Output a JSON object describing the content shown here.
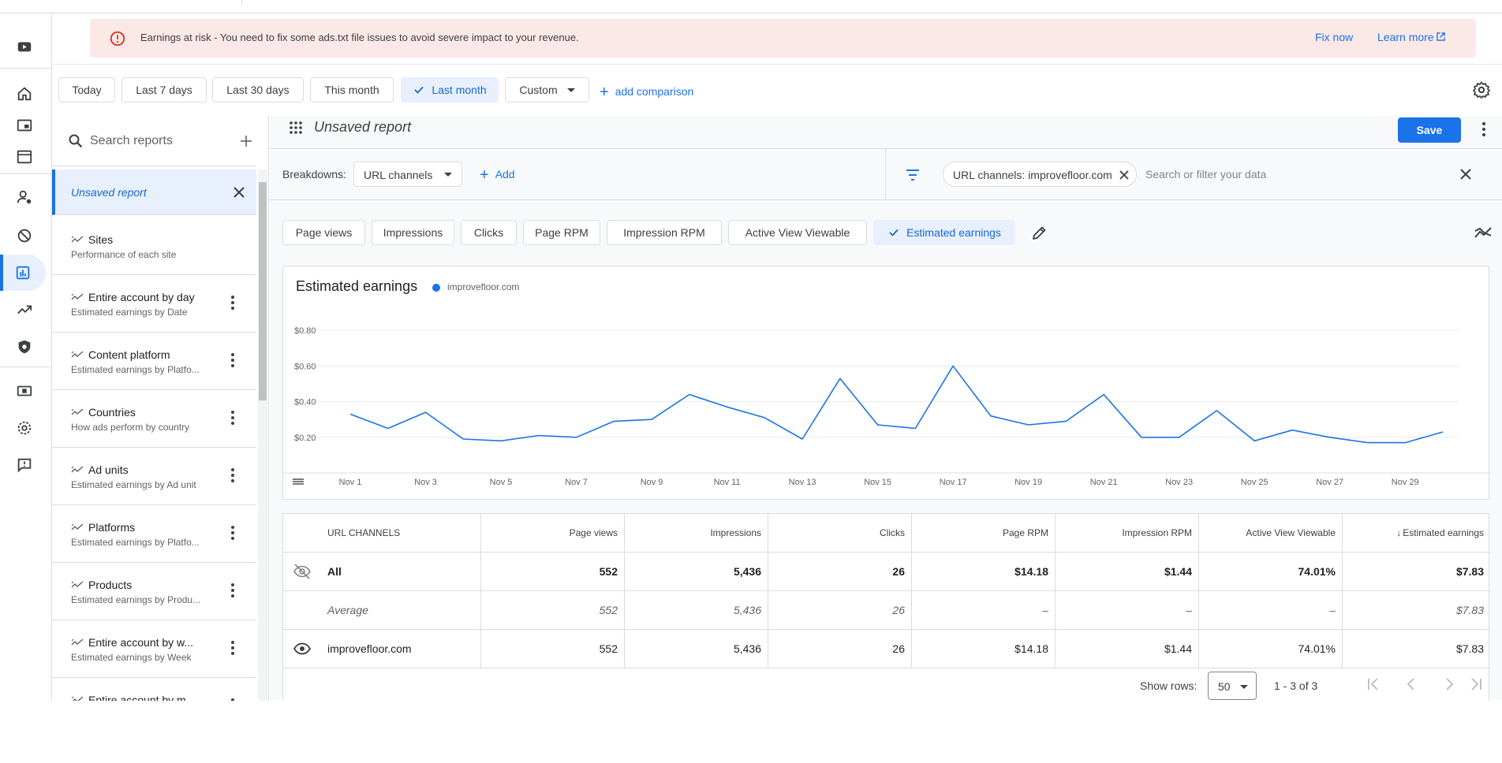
{
  "colors": {
    "accent": "#1a73e8",
    "banner_bg": "#fce8e6",
    "warning": "#d93025",
    "selected_bg": "#e8f0fe"
  },
  "rail": {
    "items": [
      {
        "icon": "youtube-icon"
      },
      {
        "icon": "home-icon"
      },
      {
        "icon": "ads-icon"
      },
      {
        "icon": "sites-icon"
      },
      {
        "icon": "privacy-messaging-icon"
      },
      {
        "icon": "blocking-controls-icon"
      },
      {
        "icon": "reports-icon"
      },
      {
        "icon": "optimization-icon"
      },
      {
        "icon": "policy-center-icon"
      },
      {
        "icon": "payments-icon"
      },
      {
        "icon": "settings-icon"
      },
      {
        "icon": "feedback-icon"
      }
    ],
    "active": "reports-icon"
  },
  "banner": {
    "message": "Earnings at risk - You need to fix some ads.txt file issues to avoid severe impact to your revenue.",
    "fix_now": "Fix now",
    "learn_more": "Learn more"
  },
  "date_range": {
    "today": "Today",
    "last7": "Last 7 days",
    "last30": "Last 30 days",
    "this_month": "This month",
    "last_month": "Last month",
    "custom": "Custom",
    "add_comparison": "add comparison",
    "selected": "Last month"
  },
  "sidebar": {
    "search_placeholder": "Search reports",
    "unsaved": "Unsaved report",
    "items": [
      {
        "title": "Sites",
        "subtitle": "Performance of each site"
      },
      {
        "title": "Entire account by day",
        "subtitle": "Estimated earnings by Date"
      },
      {
        "title": "Content platform",
        "subtitle": "Estimated earnings by Platfo..."
      },
      {
        "title": "Countries",
        "subtitle": "How ads perform by country"
      },
      {
        "title": "Ad units",
        "subtitle": "Estimated earnings by Ad unit"
      },
      {
        "title": "Platforms",
        "subtitle": "Estimated earnings by Platfo..."
      },
      {
        "title": "Products",
        "subtitle": "Estimated earnings by Produ..."
      },
      {
        "title": "Entire account by w...",
        "subtitle": "Estimated earnings by Week"
      },
      {
        "title": "Entire account by m...",
        "subtitle": ""
      }
    ]
  },
  "report": {
    "title": "Unsaved report",
    "save": "Save",
    "breakdowns_label": "Breakdowns:",
    "breakdown_value": "URL channels",
    "add": "Add",
    "filter_chip": "URL channels: improvefloor.com",
    "filter_placeholder": "Search or filter your data"
  },
  "metrics": [
    "Page views",
    "Impressions",
    "Clicks",
    "Page RPM",
    "Impression RPM",
    "Active View Viewable",
    "Estimated earnings"
  ],
  "selected_metric": "Estimated earnings",
  "chart_data": {
    "type": "line",
    "title": "Estimated earnings",
    "series": [
      {
        "name": "improvefloor.com",
        "color": "#1a73e8",
        "values": [
          0.33,
          0.25,
          0.34,
          0.19,
          0.18,
          0.21,
          0.2,
          0.29,
          0.3,
          0.44,
          0.37,
          0.31,
          0.19,
          0.53,
          0.27,
          0.25,
          0.6,
          0.32,
          0.27,
          0.29,
          0.44,
          0.2,
          0.2,
          0.35,
          0.18,
          0.24,
          0.2,
          0.17,
          0.17,
          0.23
        ]
      }
    ],
    "x": [
      "Nov 1",
      "Nov 2",
      "Nov 3",
      "Nov 4",
      "Nov 5",
      "Nov 6",
      "Nov 7",
      "Nov 8",
      "Nov 9",
      "Nov 10",
      "Nov 11",
      "Nov 12",
      "Nov 13",
      "Nov 14",
      "Nov 15",
      "Nov 16",
      "Nov 17",
      "Nov 18",
      "Nov 19",
      "Nov 20",
      "Nov 21",
      "Nov 22",
      "Nov 23",
      "Nov 24",
      "Nov 25",
      "Nov 26",
      "Nov 27",
      "Nov 28",
      "Nov 29",
      "Nov 30"
    ],
    "xtick_labels": [
      "Nov 1",
      "Nov 3",
      "Nov 5",
      "Nov 7",
      "Nov 9",
      "Nov 11",
      "Nov 13",
      "Nov 15",
      "Nov 17",
      "Nov 19",
      "Nov 21",
      "Nov 23",
      "Nov 25",
      "Nov 27",
      "Nov 29"
    ],
    "yticks": [
      0.2,
      0.4,
      0.6,
      0.8
    ],
    "ytick_labels": [
      "$0.20",
      "$0.40",
      "$0.60",
      "$0.80"
    ],
    "ylim": [
      0.0,
      0.92
    ],
    "grid": true,
    "legend": "top-left"
  },
  "table": {
    "columns": [
      "URL CHANNELS",
      "Page views",
      "Impressions",
      "Clicks",
      "Page RPM",
      "Impression RPM",
      "Active View Viewable",
      "Estimated earnings"
    ],
    "sorted_column": "Estimated earnings",
    "rows": [
      {
        "label": "All",
        "cells": [
          "552",
          "5,436",
          "26",
          "$14.18",
          "$1.44",
          "74.01%",
          "$7.83"
        ]
      },
      {
        "label": "Average",
        "cells": [
          "552",
          "5,436",
          "26",
          "–",
          "–",
          "–",
          "$7.83"
        ]
      },
      {
        "label": "improvefloor.com",
        "cells": [
          "552",
          "5,436",
          "26",
          "$14.18",
          "$1.44",
          "74.01%",
          "$7.83"
        ]
      }
    ],
    "show_rows_label": "Show rows:",
    "rows_per_page": "50",
    "range": "1 - 3 of 3"
  }
}
